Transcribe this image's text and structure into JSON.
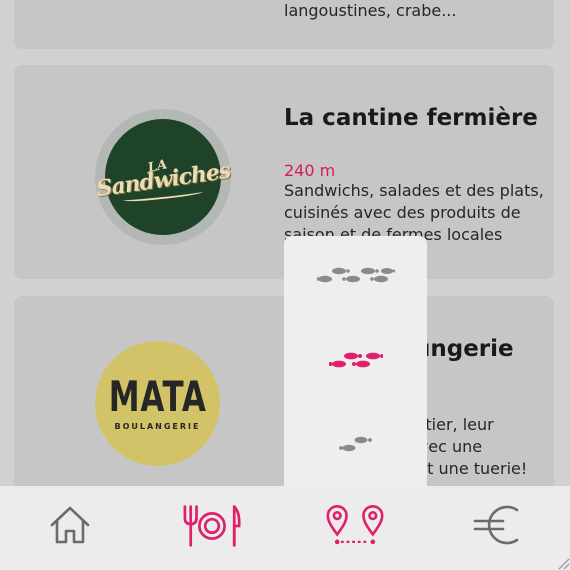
{
  "places": [
    {
      "description": "langoustines, crabe..."
    },
    {
      "name": "La cantine fermière",
      "logo_text_top": "LA",
      "logo_text_main": "Sandwiches",
      "distance": "240 m",
      "description": "Sandwichs, salades et des plats, cuisinés avec des produits de saison et de fermes locales"
    },
    {
      "name": "Mata boulangerie",
      "logo_text_main": "MATA",
      "logo_text_sub": "BOULANGERIE",
      "description": "artier, leur\navec une\nest une tuerie!"
    }
  ],
  "pace_menu": {
    "options": [
      {
        "name": "fast",
        "color": "#8a8a8a",
        "selected": false
      },
      {
        "name": "medium",
        "color": "#e0206b",
        "selected": true
      },
      {
        "name": "slow",
        "color": "#8a8a8a",
        "selected": false
      }
    ]
  },
  "nav": {
    "items": [
      {
        "icon": "home-icon",
        "color": "#6b6b6b",
        "active": false
      },
      {
        "icon": "restaurant-icon",
        "color": "#e0206b",
        "active": true
      },
      {
        "icon": "route-icon",
        "color": "#e0206b",
        "active": true
      },
      {
        "icon": "euro-icon",
        "color": "#6b6b6b",
        "active": false
      }
    ]
  },
  "colors": {
    "accent": "#e0206b",
    "overlay": "#d1d1d1",
    "card": "#c6c6c6",
    "popup": "#eeeeee"
  }
}
